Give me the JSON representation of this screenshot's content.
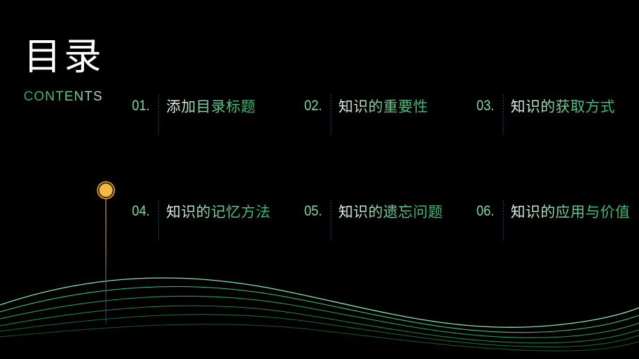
{
  "slide": {
    "title": "目录",
    "subtitle": "CONTENTS",
    "background_color": "#000000",
    "accent_color": "#3fbf79",
    "marker_color": "#f3b845",
    "rule_color": "#2a3f73",
    "number_color": "#7ed9a2"
  },
  "entries": [
    {
      "number": "01.",
      "label": "添加目录标题"
    },
    {
      "number": "02.",
      "label": "知识的重要性"
    },
    {
      "number": "03.",
      "label": "知识的获取方式"
    },
    {
      "number": "04.",
      "label": "知识的记忆方法"
    },
    {
      "number": "05.",
      "label": "知识的遗忘问题"
    },
    {
      "number": "06.",
      "label": "知识的应用与价值"
    }
  ],
  "decoration": {
    "wave_color": "#2fbf75",
    "wave_count": 6,
    "marker_icon": "circle-node-icon",
    "stem_icon": "vertical-line-icon"
  }
}
